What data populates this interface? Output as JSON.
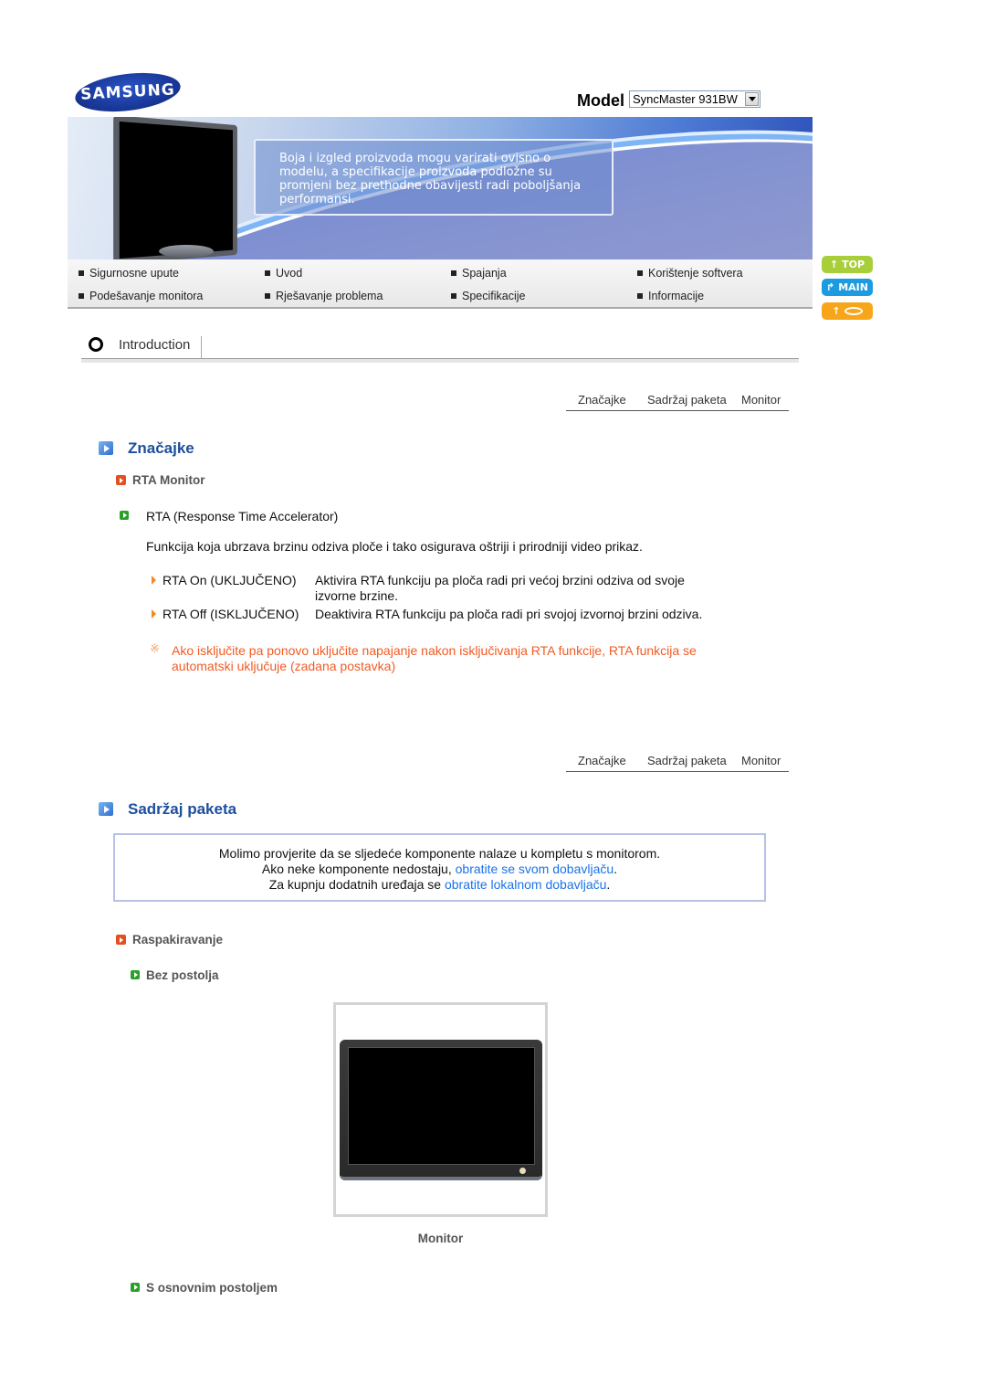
{
  "brand": {
    "logo_text": "SAMSUNG"
  },
  "model": {
    "label": "Model",
    "selected": "SyncMaster 931BW"
  },
  "banner": {
    "notice": "Boja i izgled proizvoda mogu varirati ovisno o modelu, a specifikacije proizvoda podložne su promjeni bez prethodne obavijesti radi poboljšanja performansi."
  },
  "nav": {
    "items": [
      {
        "label": "Sigurnosne upute"
      },
      {
        "label": "Uvod"
      },
      {
        "label": "Spajanja"
      },
      {
        "label": "Korištenje softvera"
      },
      {
        "label": "Podešavanje monitora"
      },
      {
        "label": "Rješavanje problema"
      },
      {
        "label": "Specifikacije"
      },
      {
        "label": "Informacije"
      }
    ]
  },
  "side_buttons": {
    "top": "TOP",
    "main": "MAIN",
    "back_icon": "arrow-up-icon"
  },
  "section": {
    "title": "Introduction"
  },
  "subtabs": [
    {
      "label": "Značajke"
    },
    {
      "label": "Sadržaj paketa"
    },
    {
      "label": "Monitor"
    }
  ],
  "features": {
    "heading": "Značajke",
    "subheading": "RTA Monitor",
    "item_title": "RTA (Response Time Accelerator)",
    "description": "Funkcija koja ubrzava brzinu odziva ploče i tako osigurava oštriji i prirodniji video prikaz.",
    "options": [
      {
        "term": "RTA On (UKLJUČENO)",
        "desc_line1": "Aktivira RTA funkciju pa ploča radi pri većoj brzini odziva od svoje",
        "desc_line2": "izvorne brzine."
      },
      {
        "term": "RTA Off (ISKLJUČENO)",
        "desc_line1": "Deaktivira RTA funkciju pa ploča radi pri svojoj izvornoj brzini odziva.",
        "desc_line2": ""
      }
    ],
    "note_line1": "Ako isključite pa ponovo uključite napajanje nakon isključivanja RTA funkcije, RTA funkcija se",
    "note_line2": "automatski uključuje (zadana postavka)",
    "note_icon": "※"
  },
  "package": {
    "heading": "Sadržaj paketa",
    "info": {
      "line1": "Molimo provjerite da se sljedeće komponente nalaze u kompletu s monitorom.",
      "line2_prefix": "Ako neke komponente nedostaju, ",
      "line2_link": "obratite se svom dobavljaču",
      "line2_suffix": ".",
      "line3_prefix": "Za kupnju dodatnih uređaja se ",
      "line3_link": "obratite lokalnom dobavljaču",
      "line3_suffix": "."
    },
    "subheading": "Raspakiravanje",
    "group1": "Bez postolja",
    "product_caption": "Monitor",
    "group2": "S osnovnim postoljem"
  },
  "colors": {
    "heading_blue": "#1c4f9c",
    "link_blue": "#1a73e8",
    "note_orange": "#f25a22",
    "top_btn": "#a8cf3a",
    "main_btn": "#1d9be0",
    "back_btn": "#f7a61a"
  }
}
